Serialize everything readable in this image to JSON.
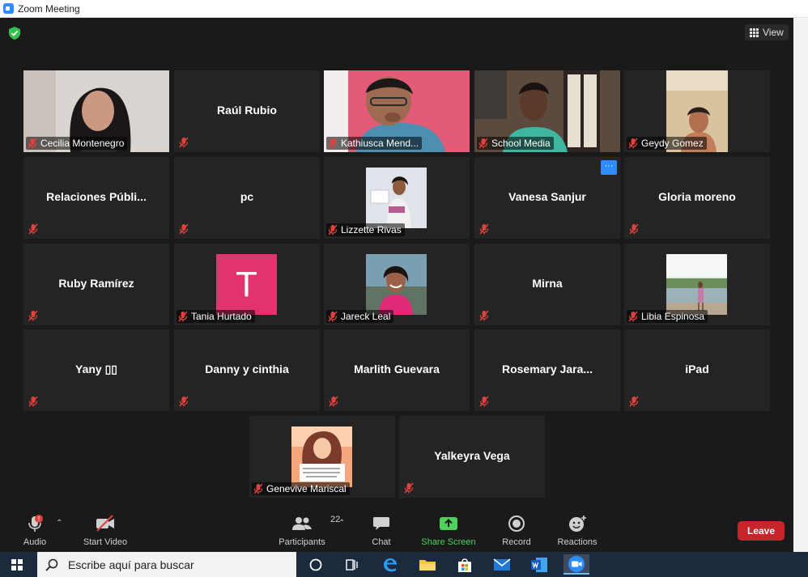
{
  "window": {
    "title": "Zoom Meeting"
  },
  "header": {
    "view_label": "View"
  },
  "participants": [
    {
      "name": "Cecilia Montenegro",
      "kind": "video",
      "active_speaker": true
    },
    {
      "name": "Raúl Rubio",
      "kind": "name"
    },
    {
      "name": "Kathiusca Mend...",
      "kind": "video"
    },
    {
      "name": "School Media",
      "kind": "video"
    },
    {
      "name": "Geydy Gomez",
      "kind": "video"
    },
    {
      "name": "Relaciones  Públi...",
      "kind": "name"
    },
    {
      "name": "pc",
      "kind": "name"
    },
    {
      "name": "Lizzette Rivas",
      "kind": "photo"
    },
    {
      "name": "Vanesa Sanjur",
      "kind": "name",
      "more_button": "···"
    },
    {
      "name": "Gloria moreno",
      "kind": "name"
    },
    {
      "name": "Ruby Ramírez",
      "kind": "name"
    },
    {
      "name": "Tania Hurtado",
      "kind": "avatar",
      "initial": "T",
      "avatar_color": "#e0336f"
    },
    {
      "name": "Jareck Leal",
      "kind": "photo"
    },
    {
      "name": "Mirna",
      "kind": "name"
    },
    {
      "name": "Libia Espinosa",
      "kind": "photo"
    },
    {
      "name": "Yany ▯▯",
      "kind": "name"
    },
    {
      "name": "Danny y cinthia",
      "kind": "name"
    },
    {
      "name": "Marlith Guevara",
      "kind": "name"
    },
    {
      "name": "Rosemary Jara...",
      "kind": "name"
    },
    {
      "name": "iPad",
      "kind": "name"
    },
    {
      "name": "Genevive Mariscal",
      "kind": "photo"
    },
    {
      "name": "Yalkeyra Vega",
      "kind": "name"
    }
  ],
  "toolbar": {
    "audio_label": "Audio",
    "audio_alert": "!",
    "video_label": "Start Video",
    "participants_label": "Participants",
    "participants_count": "22",
    "chat_label": "Chat",
    "share_label": "Share Screen",
    "record_label": "Record",
    "reactions_label": "Reactions",
    "leave_label": "Leave"
  },
  "taskbar": {
    "search_placeholder": "Escribe aquí para buscar",
    "apps": [
      "cortana-icon",
      "task-view-icon",
      "edge-icon",
      "file-explorer-icon",
      "store-icon",
      "mail-icon",
      "word-icon",
      "zoom-icon"
    ]
  },
  "colors": {
    "background": "#1a1a1a",
    "tile": "#242424",
    "active_speaker_border": "#e8e98a",
    "share_green": "#4fd15e",
    "leave_red": "#c7252b",
    "muted_red": "#e0413c"
  }
}
